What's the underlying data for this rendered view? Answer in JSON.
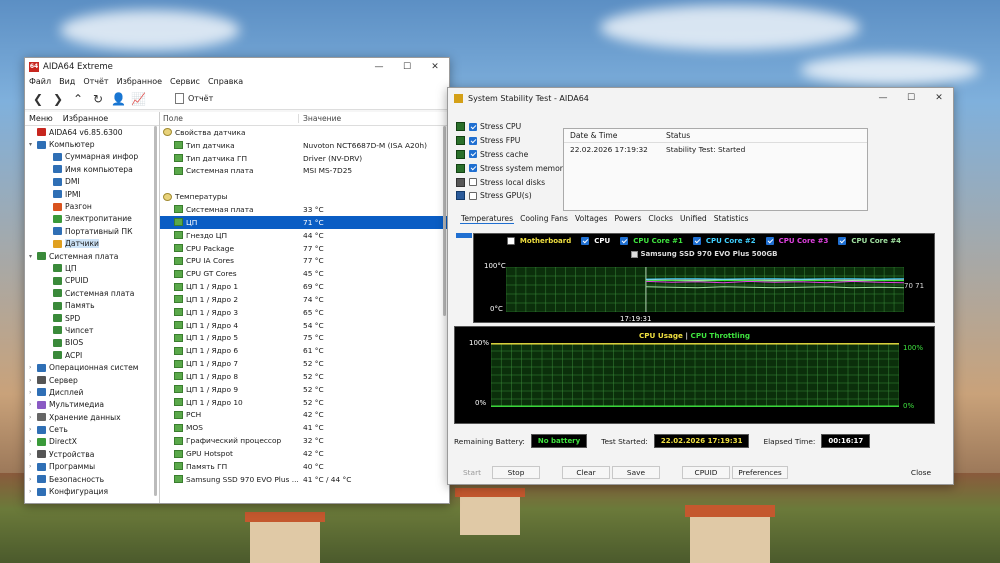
{
  "colors": {
    "accent": "#1f6fd1",
    "chart_bg": "#000000",
    "plot_bg": "#0b2f0b",
    "lcd_text": "#3fe33f",
    "yellow": "#f0e040",
    "white": "#ffffff"
  },
  "aida": {
    "title": "AIDA64 Extreme",
    "menu": [
      "Файл",
      "Вид",
      "Отчёт",
      "Избранное",
      "Сервис",
      "Справка"
    ],
    "toolbar_icons": [
      "back-icon",
      "forward-icon",
      "up-icon",
      "refresh-icon",
      "user-icon",
      "chart-icon"
    ],
    "report_label": "Отчёт",
    "left_tabs": [
      "Меню",
      "Избранное"
    ],
    "tree": [
      {
        "label": "AIDA64 v6.85.6300",
        "indent": 0,
        "arrow": "",
        "color": "#c7261f"
      },
      {
        "label": "Компьютер",
        "indent": 0,
        "arrow": "▾",
        "color": "#2f6fb5"
      },
      {
        "label": "Суммарная инфор",
        "indent": 2,
        "arrow": "",
        "color": "#2f6fb5"
      },
      {
        "label": "Имя компьютера",
        "indent": 2,
        "arrow": "",
        "color": "#2f6fb5"
      },
      {
        "label": "DMI",
        "indent": 2,
        "arrow": "",
        "color": "#2f6fb5"
      },
      {
        "label": "IPMI",
        "indent": 2,
        "arrow": "",
        "color": "#2f6fb5"
      },
      {
        "label": "Разгон",
        "indent": 2,
        "arrow": "",
        "color": "#d9531e"
      },
      {
        "label": "Электропитание",
        "indent": 2,
        "arrow": "",
        "color": "#3a9a3a"
      },
      {
        "label": "Портативный ПК",
        "indent": 2,
        "arrow": "",
        "color": "#2f6fb5"
      },
      {
        "label": "Датчики",
        "indent": 2,
        "arrow": "",
        "color": "#e0a020",
        "selected": true
      },
      {
        "label": "Системная плата",
        "indent": 0,
        "arrow": "▾",
        "color": "#3a8a3a"
      },
      {
        "label": "ЦП",
        "indent": 2,
        "arrow": "",
        "color": "#3a8a3a"
      },
      {
        "label": "CPUID",
        "indent": 2,
        "arrow": "",
        "color": "#3a8a3a"
      },
      {
        "label": "Системная плата",
        "indent": 2,
        "arrow": "",
        "color": "#3a8a3a"
      },
      {
        "label": "Память",
        "indent": 2,
        "arrow": "",
        "color": "#3a8a3a"
      },
      {
        "label": "SPD",
        "indent": 2,
        "arrow": "",
        "color": "#3a8a3a"
      },
      {
        "label": "Чипсет",
        "indent": 2,
        "arrow": "",
        "color": "#3a8a3a"
      },
      {
        "label": "BIOS",
        "indent": 2,
        "arrow": "",
        "color": "#3a8a3a"
      },
      {
        "label": "ACPI",
        "indent": 2,
        "arrow": "",
        "color": "#3a8a3a"
      },
      {
        "label": "Операционная систем",
        "indent": 0,
        "arrow": "›",
        "color": "#2f6fb5"
      },
      {
        "label": "Сервер",
        "indent": 0,
        "arrow": "›",
        "color": "#555555"
      },
      {
        "label": "Дисплей",
        "indent": 0,
        "arrow": "›",
        "color": "#2f6fb5"
      },
      {
        "label": "Мультимедиа",
        "indent": 0,
        "arrow": "›",
        "color": "#8a5ac4"
      },
      {
        "label": "Хранение данных",
        "indent": 0,
        "arrow": "›",
        "color": "#666666"
      },
      {
        "label": "Сеть",
        "indent": 0,
        "arrow": "›",
        "color": "#2f6fb5"
      },
      {
        "label": "DirectX",
        "indent": 0,
        "arrow": "›",
        "color": "#3a9a3a"
      },
      {
        "label": "Устройства",
        "indent": 0,
        "arrow": "›",
        "color": "#555555"
      },
      {
        "label": "Программы",
        "indent": 0,
        "arrow": "›",
        "color": "#2f6fb5"
      },
      {
        "label": "Безопасность",
        "indent": 0,
        "arrow": "›",
        "color": "#2f6fb5"
      },
      {
        "label": "Конфигурация",
        "indent": 0,
        "arrow": "›",
        "color": "#2f6fb5"
      }
    ],
    "columns": {
      "field": "Поле",
      "value": "Значение"
    },
    "rows": [
      {
        "name": "Свойства датчика",
        "value": "",
        "group": true
      },
      {
        "name": "Тип датчика",
        "value": "Nuvoton NCT6687D-M  (ISA A20h)"
      },
      {
        "name": "Тип датчика ГП",
        "value": "Driver  (NV-DRV)"
      },
      {
        "name": "Системная плата",
        "value": "MSI MS-7D25"
      },
      {
        "name": "",
        "value": "",
        "spacer": true
      },
      {
        "name": "Температуры",
        "value": "",
        "group": true
      },
      {
        "name": "Системная плата",
        "value": "33 °C"
      },
      {
        "name": "ЦП",
        "value": "71 °C",
        "selected": true
      },
      {
        "name": "Гнездо ЦП",
        "value": "44 °C"
      },
      {
        "name": "CPU Package",
        "value": "77 °C"
      },
      {
        "name": "CPU IA Cores",
        "value": "77 °C"
      },
      {
        "name": "CPU GT Cores",
        "value": "45 °C"
      },
      {
        "name": "ЦП 1 / Ядро 1",
        "value": "69 °C"
      },
      {
        "name": "ЦП 1 / Ядро 2",
        "value": "74 °C"
      },
      {
        "name": "ЦП 1 / Ядро 3",
        "value": "65 °C"
      },
      {
        "name": "ЦП 1 / Ядро 4",
        "value": "54 °C"
      },
      {
        "name": "ЦП 1 / Ядро 5",
        "value": "75 °C"
      },
      {
        "name": "ЦП 1 / Ядро 6",
        "value": "61 °C"
      },
      {
        "name": "ЦП 1 / Ядро 7",
        "value": "52 °C"
      },
      {
        "name": "ЦП 1 / Ядро 8",
        "value": "52 °C"
      },
      {
        "name": "ЦП 1 / Ядро 9",
        "value": "52 °C"
      },
      {
        "name": "ЦП 1 / Ядро 10",
        "value": "52 °C"
      },
      {
        "name": "PCH",
        "value": "42 °C"
      },
      {
        "name": "MOS",
        "value": "41 °C"
      },
      {
        "name": "Графический процессор",
        "value": "32 °C"
      },
      {
        "name": "GPU Hotspot",
        "value": "42 °C"
      },
      {
        "name": "Память ГП",
        "value": "40 °C"
      },
      {
        "name": "Samsung SSD 970 EVO Plus ...",
        "value": "41 °C / 44 °C"
      }
    ]
  },
  "stab": {
    "title": "System Stability Test - AIDA64",
    "stress": [
      {
        "label": "Stress CPU",
        "checked": true
      },
      {
        "label": "Stress FPU",
        "checked": true
      },
      {
        "label": "Stress cache",
        "checked": true
      },
      {
        "label": "Stress system memory",
        "checked": true
      },
      {
        "label": "Stress local disks",
        "checked": false
      },
      {
        "label": "Stress GPU(s)",
        "checked": false
      }
    ],
    "status_header": {
      "date": "Date & Time",
      "status": "Status"
    },
    "status_row": {
      "date": "22.02.2026 17:19:32",
      "status": "Stability Test: Started"
    },
    "tabs": [
      "Temperatures",
      "Cooling Fans",
      "Voltages",
      "Powers",
      "Clocks",
      "Unified",
      "Statistics"
    ],
    "chart1": {
      "legend": [
        {
          "label": "Motherboard",
          "color": "#f0e040",
          "checked": false
        },
        {
          "label": "CPU",
          "color": "#ffffff",
          "checked": true
        },
        {
          "label": "CPU Core #1",
          "color": "#3fe33f",
          "checked": true
        },
        {
          "label": "CPU Core #2",
          "color": "#40d0ff",
          "checked": true
        },
        {
          "label": "CPU Core #3",
          "color": "#e040e0",
          "checked": true
        },
        {
          "label": "CPU Core #4",
          "color": "#a0e0a0",
          "checked": true
        }
      ],
      "legend2": "Samsung SSD 970 EVO Plus 500GB",
      "y_top": "100°C",
      "y_bottom": "0°C",
      "x_label": "17:19:31",
      "end_label": "70 71"
    },
    "chart2": {
      "title_a": "CPU Usage",
      "sep": "|",
      "title_b": "CPU Throttling",
      "y_top_left": "100%",
      "y_bottom_left": "0%",
      "y_top_right": "100%",
      "y_bottom_right": "0%"
    },
    "info": {
      "battery_label": "Remaining Battery:",
      "battery_value": "No battery",
      "started_label": "Test Started:",
      "started_value": "22.02.2026 17:19:31",
      "elapsed_label": "Elapsed Time:",
      "elapsed_value": "00:16:17"
    },
    "buttons": {
      "start": "Start",
      "stop": "Stop",
      "clear": "Clear",
      "save": "Save",
      "cpuid": "CPUID",
      "preferences": "Preferences",
      "close": "Close"
    }
  },
  "chart_data": [
    {
      "type": "line",
      "legend_position": "top",
      "grid": true,
      "ylim": [
        0,
        100
      ],
      "y_tick_labels": [
        "100°C",
        "0°C"
      ],
      "x_tick_labels": [
        "17:19:31"
      ],
      "series": [
        {
          "name": "CPU",
          "values": [
            null,
            71,
            71,
            71,
            71,
            71,
            71,
            71,
            71,
            71,
            71,
            71
          ]
        },
        {
          "name": "CPU Core #1",
          "values": [
            null,
            70,
            70,
            69,
            70,
            70,
            69,
            70,
            70,
            69,
            70,
            70
          ]
        },
        {
          "name": "CPU Core #2",
          "values": [
            null,
            73,
            74,
            74,
            73,
            74,
            74,
            73,
            74,
            74,
            73,
            74
          ]
        },
        {
          "name": "CPU Core #3",
          "values": [
            null,
            68,
            66,
            67,
            65,
            68,
            66,
            67,
            65,
            68,
            66,
            65
          ]
        },
        {
          "name": "CPU Core #4",
          "values": [
            null,
            56,
            55,
            54,
            56,
            55,
            54,
            55,
            56,
            54,
            55,
            54
          ]
        }
      ]
    },
    {
      "type": "line",
      "legend_position": "top",
      "grid": true,
      "ylim": [
        0,
        100
      ],
      "y_tick_labels": [
        "100%",
        "0%"
      ],
      "series": [
        {
          "name": "CPU Usage",
          "values": [
            100,
            100,
            100,
            100,
            100,
            100,
            100,
            100,
            100,
            100,
            100,
            100
          ]
        },
        {
          "name": "CPU Throttling",
          "values": [
            0,
            0,
            0,
            0,
            0,
            0,
            0,
            0,
            0,
            0,
            0,
            0
          ]
        }
      ]
    }
  ]
}
